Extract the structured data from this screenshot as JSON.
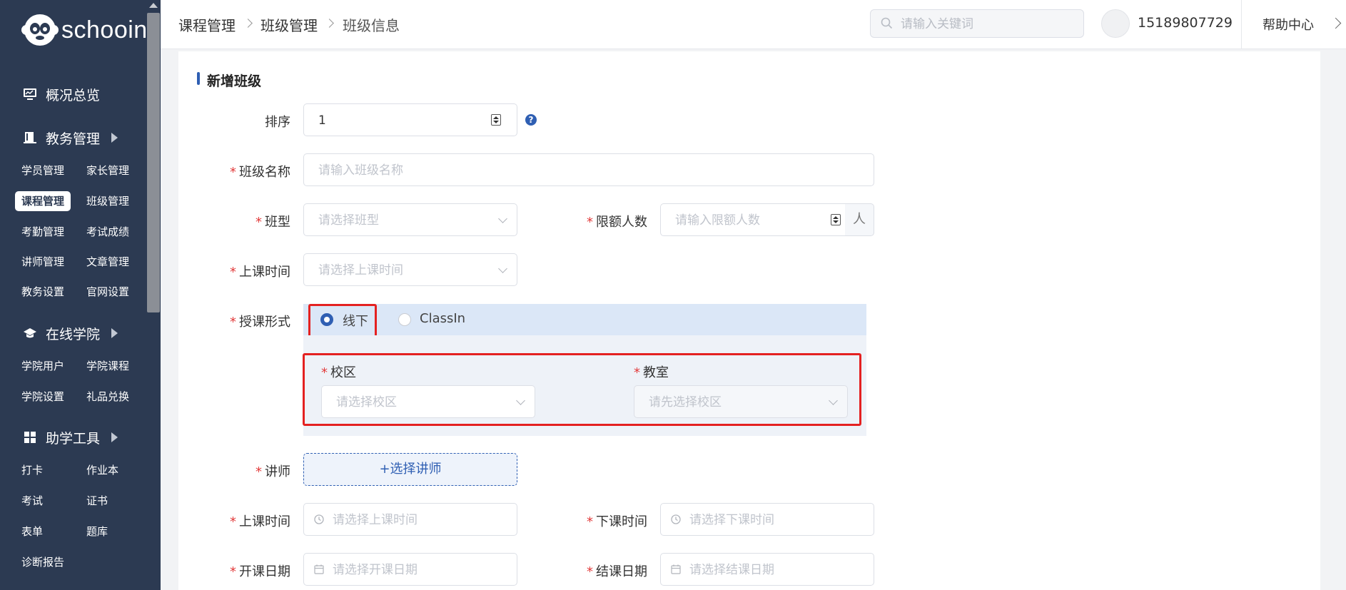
{
  "sidebar": {
    "brand": "schooin",
    "sections": [
      {
        "label": "概况总览",
        "icon": "monitor-icon",
        "has_arrow": false
      },
      {
        "label": "教务管理",
        "icon": "book-icon",
        "has_arrow": true
      },
      {
        "label": "在线学院",
        "icon": "graduation-cap-icon",
        "has_arrow": true
      },
      {
        "label": "助学工具",
        "icon": "grid-icon",
        "has_arrow": true
      }
    ],
    "edu_items": [
      "学员管理",
      "家长管理",
      "课程管理",
      "班级管理",
      "考勤管理",
      "考试成绩",
      "讲师管理",
      "文章管理",
      "教务设置",
      "官网设置"
    ],
    "active_item": "课程管理",
    "online_items": [
      "学院用户",
      "学院课程",
      "学院设置",
      "礼品兑换"
    ],
    "tool_items": [
      "打卡",
      "作业本",
      "考试",
      "证书",
      "表单",
      "题库",
      "诊断报告"
    ]
  },
  "header": {
    "breadcrumb": [
      "课程管理",
      "班级管理",
      "班级信息"
    ],
    "search_placeholder": "请输入关键词",
    "user_phone": "15189807729",
    "help_label": "帮助中心"
  },
  "form": {
    "title": "新增班级",
    "sort": {
      "label": "排序",
      "value": "1"
    },
    "class_name": {
      "label": "班级名称",
      "placeholder": "请输入班级名称"
    },
    "class_type": {
      "label": "班型",
      "placeholder": "请选择班型"
    },
    "limit": {
      "label": "限额人数",
      "placeholder": "请输入限额人数",
      "suffix": "人"
    },
    "schedule": {
      "label": "上课时间",
      "placeholder": "请选择上课时间"
    },
    "mode": {
      "label": "授课形式",
      "options": [
        "线下",
        "ClassIn"
      ],
      "selected": "线下"
    },
    "campus": {
      "label": "校区",
      "placeholder": "请选择校区"
    },
    "classroom": {
      "label": "教室",
      "placeholder": "请先选择校区"
    },
    "teacher": {
      "label": "讲师",
      "button": "+选择讲师"
    },
    "start_time": {
      "label": "上课时间",
      "placeholder": "请选择上课时间"
    },
    "end_time": {
      "label": "下课时间",
      "placeholder": "请选择下课时间"
    },
    "start_date": {
      "label": "开课日期",
      "placeholder": "请选择开课日期"
    },
    "end_date": {
      "label": "结课日期",
      "placeholder": "请选择结课日期"
    }
  },
  "colors": {
    "sidebar_bg": "#2c3a52",
    "accent": "#2f5fb3",
    "required": "#e23b3b",
    "highlight": "#e42121"
  }
}
